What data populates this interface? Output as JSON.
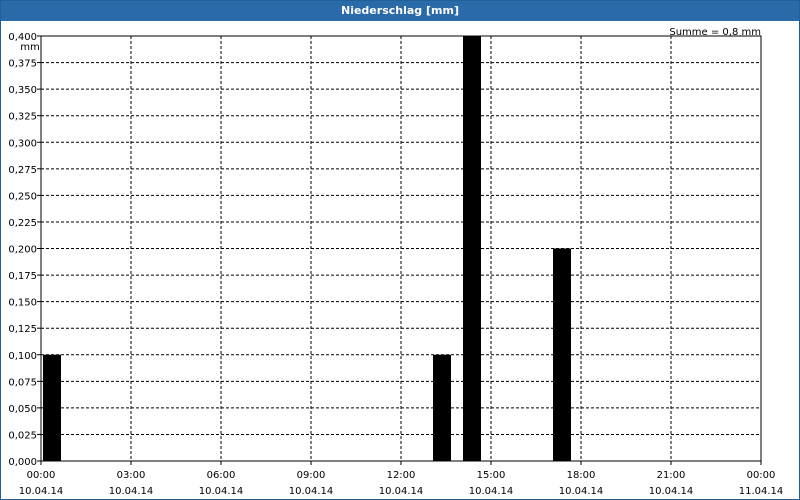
{
  "window": {
    "title": "Niederschlag [mm]"
  },
  "chart_data": {
    "type": "bar",
    "title": "Niederschlag [mm]",
    "ylabel": "mm",
    "summary": "Summe = 0,8 mm",
    "ylim": [
      0,
      0.4
    ],
    "yticks": [
      "0,000",
      "0,025",
      "0,050",
      "0,075",
      "0,100",
      "0,125",
      "0,150",
      "0,175",
      "0,200",
      "0,225",
      "0,250",
      "0,275",
      "0,300",
      "0,325",
      "0,350",
      "0,375",
      "0,400"
    ],
    "xticks": [
      {
        "time": "00:00",
        "date": "10.04.14"
      },
      {
        "time": "03:00",
        "date": "10.04.14"
      },
      {
        "time": "06:00",
        "date": "10.04.14"
      },
      {
        "time": "09:00",
        "date": "10.04.14"
      },
      {
        "time": "12:00",
        "date": "10.04.14"
      },
      {
        "time": "15:00",
        "date": "10.04.14"
      },
      {
        "time": "18:00",
        "date": "10.04.14"
      },
      {
        "time": "21:00",
        "date": "10.04.14"
      },
      {
        "time": "00:00",
        "date": "11.04.14"
      }
    ],
    "x_hours": [
      0,
      24
    ],
    "bars": [
      {
        "start": "00:00",
        "end": "00:40",
        "value": 0.1
      },
      {
        "start": "13:00",
        "end": "13:40",
        "value": 0.1
      },
      {
        "start": "14:00",
        "end": "14:40",
        "value": 0.4
      },
      {
        "start": "17:00",
        "end": "17:40",
        "value": 0.2
      }
    ],
    "grid": true,
    "bar_color": "#000000"
  }
}
